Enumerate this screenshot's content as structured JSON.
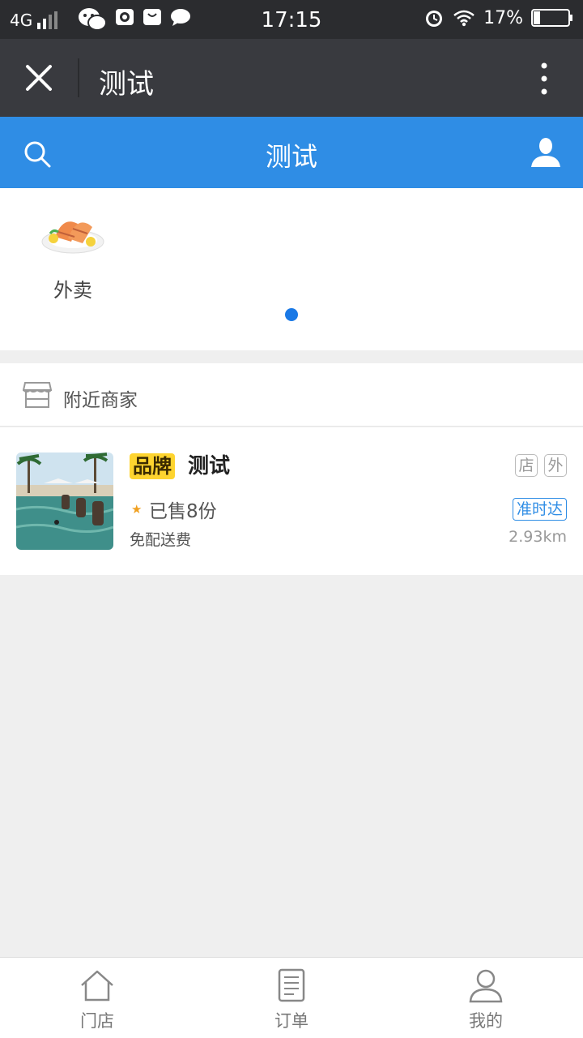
{
  "status_bar": {
    "network": "4G",
    "time": "17:15",
    "battery": "17%"
  },
  "wechat_bar": {
    "title": "测试"
  },
  "header": {
    "title": "测试"
  },
  "categories": [
    {
      "label": "外卖",
      "icon": "grilled-salmon-dish"
    }
  ],
  "nearby": {
    "title": "附近商家"
  },
  "shops": [
    {
      "brand_badge": "品牌",
      "name": "测试",
      "tags": [
        "店",
        "外"
      ],
      "sold": "已售8份",
      "ontime": "准时达",
      "shipping": "免配送费",
      "distance": "2.93km"
    }
  ],
  "tabs": [
    {
      "label": "门店",
      "icon": "home-icon"
    },
    {
      "label": "订单",
      "icon": "order-list-icon"
    },
    {
      "label": "我的",
      "icon": "person-icon"
    }
  ],
  "colors": {
    "header_blue": "#2f8de5",
    "wechat_bar": "#393a3f",
    "brand_yellow": "#fed42f"
  }
}
